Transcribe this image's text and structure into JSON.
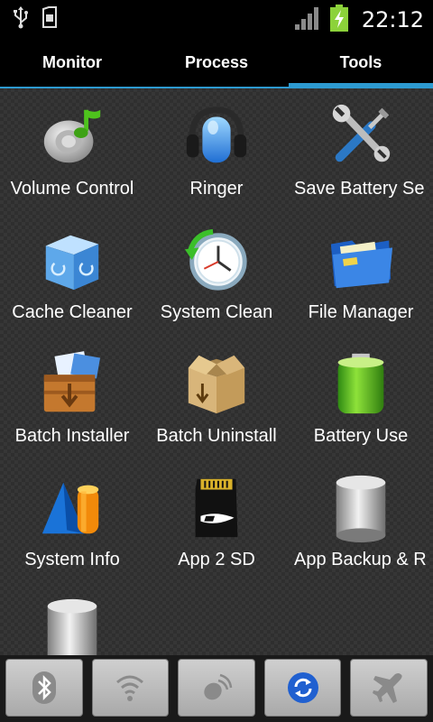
{
  "status_bar": {
    "time": "22:12",
    "icons": [
      "usb-icon",
      "sd-card-icon",
      "signal-icon",
      "battery-charging-icon"
    ]
  },
  "tabs": [
    {
      "label": "Monitor",
      "active": false
    },
    {
      "label": "Process",
      "active": false
    },
    {
      "label": "Tools",
      "active": true
    }
  ],
  "tools": [
    {
      "label": "Volume Control",
      "icon": "volume-control-icon"
    },
    {
      "label": "Ringer",
      "icon": "headphones-icon"
    },
    {
      "label": "Save Battery Se",
      "icon": "wrench-screwdriver-icon"
    },
    {
      "label": "Cache Cleaner",
      "icon": "recycle-box-icon"
    },
    {
      "label": "System Clean",
      "icon": "clock-refresh-icon"
    },
    {
      "label": "File Manager",
      "icon": "folder-icon"
    },
    {
      "label": "Batch Installer",
      "icon": "box-install-icon"
    },
    {
      "label": "Batch Uninstall",
      "icon": "open-box-icon"
    },
    {
      "label": "Battery Use",
      "icon": "battery-icon"
    },
    {
      "label": "System Info",
      "icon": "shapes-icon"
    },
    {
      "label": "App 2 SD",
      "icon": "sd-card-icon"
    },
    {
      "label": "App Backup & R",
      "icon": "database-icon"
    },
    {
      "label": "",
      "icon": "database-icon"
    }
  ],
  "toolbar": [
    {
      "icon": "bluetooth-icon"
    },
    {
      "icon": "wifi-icon"
    },
    {
      "icon": "gps-icon"
    },
    {
      "icon": "sync-icon",
      "accent": "#2060d0"
    },
    {
      "icon": "airplane-icon"
    }
  ],
  "colors": {
    "accent": "#2d9ad0"
  }
}
